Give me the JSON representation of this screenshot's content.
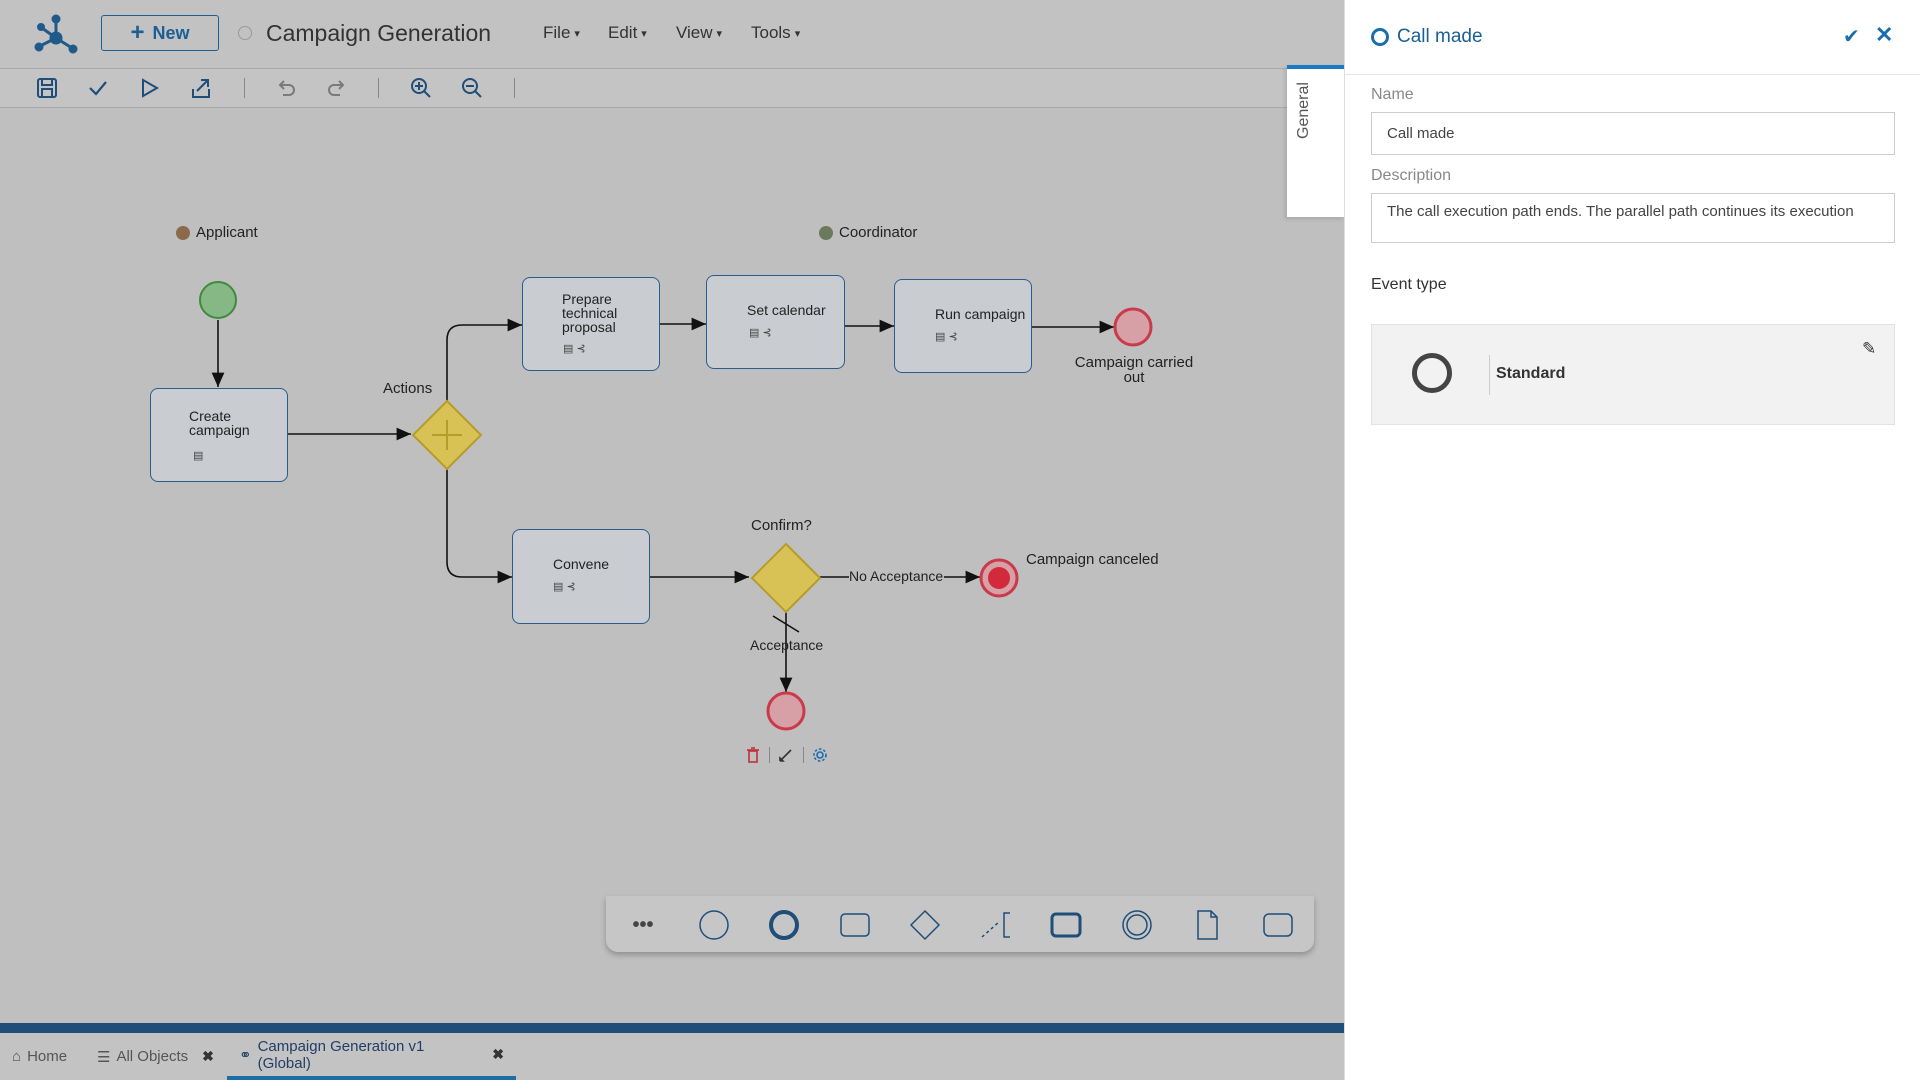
{
  "header": {
    "new_label": "New",
    "title": "Campaign Generation",
    "menus": [
      "File",
      "Edit",
      "View",
      "Tools"
    ]
  },
  "diagram": {
    "lanes": [
      "Applicant",
      "Coordinator"
    ],
    "tasks": {
      "create_campaign": [
        "Create",
        "campaign"
      ],
      "prepare_proposal": [
        "Prepare",
        "technical",
        "proposal"
      ],
      "set_calendar": "Set calendar",
      "run_campaign": "Run campaign",
      "convene": "Convene"
    },
    "labels": {
      "actions": "Actions",
      "confirm": "Confirm?",
      "no_acceptance": "No Acceptance",
      "acceptance": "Acceptance",
      "campaign_carried_out": [
        "Campaign carried",
        "out"
      ],
      "campaign_canceled": "Campaign canceled"
    }
  },
  "tabs": [
    {
      "label": "Home",
      "icon": "home-icon"
    },
    {
      "label": "All Objects",
      "icon": "list-icon"
    },
    {
      "label": "Campaign Generation v1 (Global)",
      "icon": "process-icon"
    }
  ],
  "panel": {
    "title": "Call made",
    "side_tab": "General",
    "name_label": "Name",
    "name_value": "Call made",
    "description_label": "Description",
    "description_value": "The call execution path ends. The parallel path continues its execution",
    "event_type_label": "Event type",
    "event_type_value": "Standard"
  },
  "colors": {
    "accent": "#1a6eae",
    "start_event": "#7fbf7f",
    "end_event": "#e04050",
    "gateway": "#e0c84a"
  }
}
